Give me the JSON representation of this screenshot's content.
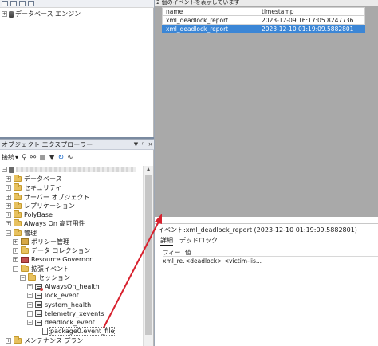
{
  "left_top": {
    "tree_root_label": "データベース エンジン"
  },
  "object_explorer": {
    "title": "オブジェクト エクスプローラー",
    "controls": [
      "▼",
      "ᵖ",
      "×"
    ],
    "toolbar": {
      "connect_label": "接続",
      "connect_arrow": "▾"
    },
    "tree": [
      {
        "label": "データベース",
        "indent": 1,
        "expander": "+",
        "icon": "folder"
      },
      {
        "label": "セキュリティ",
        "indent": 1,
        "expander": "+",
        "icon": "folder"
      },
      {
        "label": "サーバー オブジェクト",
        "indent": 1,
        "expander": "+",
        "icon": "folder"
      },
      {
        "label": "レプリケーション",
        "indent": 1,
        "expander": "+",
        "icon": "folder"
      },
      {
        "label": "PolyBase",
        "indent": 1,
        "expander": "+",
        "icon": "folder"
      },
      {
        "label": "Always On 高可用性",
        "indent": 1,
        "expander": "+",
        "icon": "folder"
      },
      {
        "label": "管理",
        "indent": 1,
        "expander": "−",
        "icon": "folder"
      },
      {
        "label": "ポリシー管理",
        "indent": 2,
        "expander": "+",
        "icon": "policy"
      },
      {
        "label": "データ コレクション",
        "indent": 2,
        "expander": "+",
        "icon": "folder"
      },
      {
        "label": "Resource Governor",
        "indent": 2,
        "expander": "+",
        "icon": "governor"
      },
      {
        "label": "拡張イベント",
        "indent": 2,
        "expander": "−",
        "icon": "folder"
      },
      {
        "label": "セッション",
        "indent": 3,
        "expander": "−",
        "icon": "folder"
      },
      {
        "label": "AlwaysOn_health",
        "indent": 4,
        "expander": "+",
        "icon": "session-stopped"
      },
      {
        "label": "lock_event",
        "indent": 4,
        "expander": "+",
        "icon": "session"
      },
      {
        "label": "system_health",
        "indent": 4,
        "expander": "+",
        "icon": "session"
      },
      {
        "label": "telemetry_xevents",
        "indent": 4,
        "expander": "+",
        "icon": "session"
      },
      {
        "label": "deadlock_event",
        "indent": 4,
        "expander": "−",
        "icon": "session"
      },
      {
        "label": "package0.event_file",
        "indent": 5,
        "expander": "",
        "icon": "file"
      },
      {
        "label": "メンテナンス プラン",
        "indent": 1,
        "expander": "+",
        "icon": "folder"
      }
    ]
  },
  "events_grid": {
    "status_text": "2 個のイベントを表示しています",
    "headers": {
      "name": "name",
      "timestamp": "timestamp"
    },
    "rows": [
      {
        "name": "xml_deadlock_report",
        "timestamp": "2023-12-09 16:17:05.8247736",
        "selected": false
      },
      {
        "name": "xml_deadlock_report",
        "timestamp": "2023-12-10 01:19:09.5882801",
        "selected": true
      }
    ]
  },
  "details": {
    "title": "イベント:xml_deadlock_report (2023-12-10 01:19:09.5882801)",
    "tabs": [
      "詳細",
      "デッドロック"
    ],
    "grid_headers": [
      "フィー...",
      "値"
    ],
    "grid_rows": [
      [
        "xml_re...",
        "<deadlock> <victim-lis..."
      ]
    ]
  },
  "colors": {
    "selection": "#3b86d6",
    "grid_background": "#a9a9a9",
    "arrow": "#d8212e"
  }
}
